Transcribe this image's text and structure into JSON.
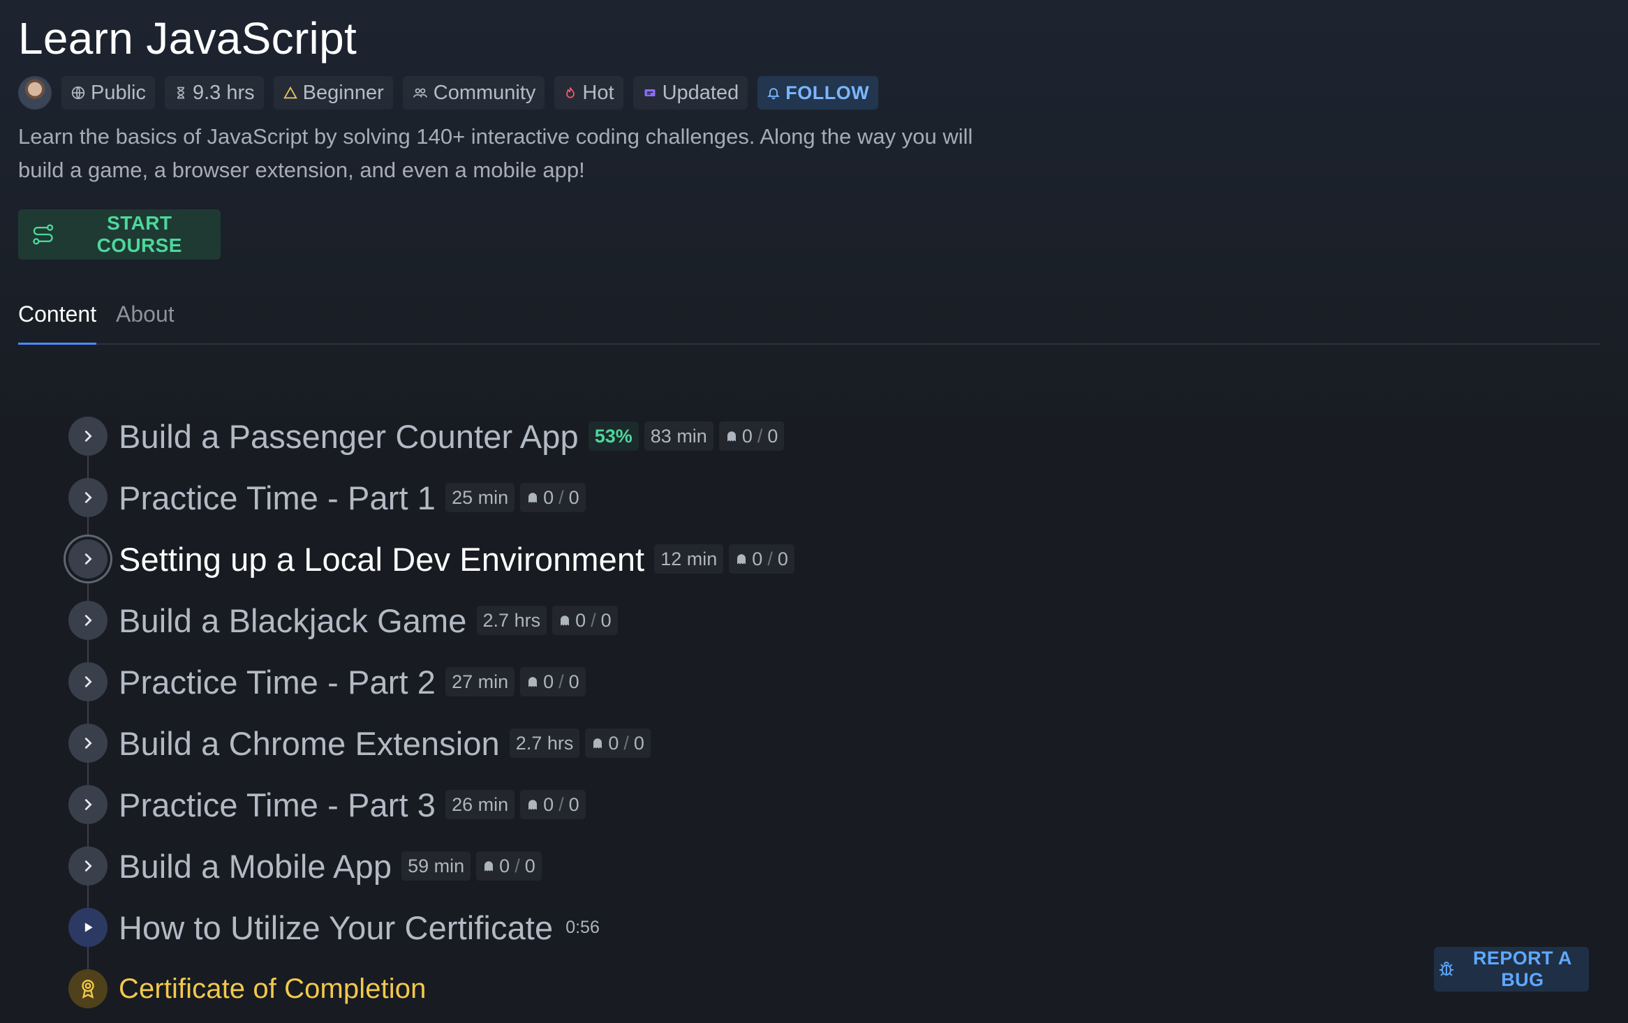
{
  "course": {
    "title": "Learn JavaScript",
    "description": "Learn the basics of JavaScript by solving 140+ interactive coding challenges. Along the way you will build a game, a browser extension, and even a mobile app!",
    "start_label": "START COURSE"
  },
  "meta": {
    "visibility": "Public",
    "duration": "9.3 hrs",
    "level": "Beginner",
    "community": "Community",
    "hot": "Hot",
    "updated": "Updated",
    "follow": "FOLLOW"
  },
  "tabs": {
    "content": "Content",
    "about": "About"
  },
  "modules": [
    {
      "title": "Build a Passenger Counter App",
      "progress": "53%",
      "duration": "83 min",
      "done": "0",
      "total": "0"
    },
    {
      "title": "Practice Time - Part 1",
      "duration": "25 min",
      "done": "0",
      "total": "0"
    },
    {
      "title": "Setting up a Local Dev Environment",
      "duration": "12 min",
      "done": "0",
      "total": "0"
    },
    {
      "title": "Build a Blackjack Game",
      "duration": "2.7 hrs",
      "done": "0",
      "total": "0"
    },
    {
      "title": "Practice Time - Part 2",
      "duration": "27 min",
      "done": "0",
      "total": "0"
    },
    {
      "title": "Build a Chrome Extension",
      "duration": "2.7 hrs",
      "done": "0",
      "total": "0"
    },
    {
      "title": "Practice Time - Part 3",
      "duration": "26 min",
      "done": "0",
      "total": "0"
    },
    {
      "title": "Build a Mobile App",
      "duration": "59 min",
      "done": "0",
      "total": "0"
    },
    {
      "title": "How to Utilize Your Certificate",
      "duration": "0:56"
    },
    {
      "title": "Certificate of Completion"
    }
  ],
  "report_label": "REPORT A BUG",
  "icons": {
    "globe": "globe-icon",
    "hourglass": "hourglass-icon",
    "triangle": "triangle-icon",
    "people": "people-icon",
    "fire": "fire-icon",
    "updated": "updated-icon",
    "bell": "bell-icon",
    "route": "route-icon",
    "chevron": "chevron-right-icon",
    "ghost": "ghost-icon",
    "play": "play-icon",
    "award": "award-icon",
    "bug": "bug-icon"
  },
  "colors": {
    "accent_green": "#4ed79c",
    "accent_blue": "#5fa8ff",
    "gold": "#f2c94c",
    "hot": "#ff5a6e",
    "updated": "#8b6cff"
  }
}
